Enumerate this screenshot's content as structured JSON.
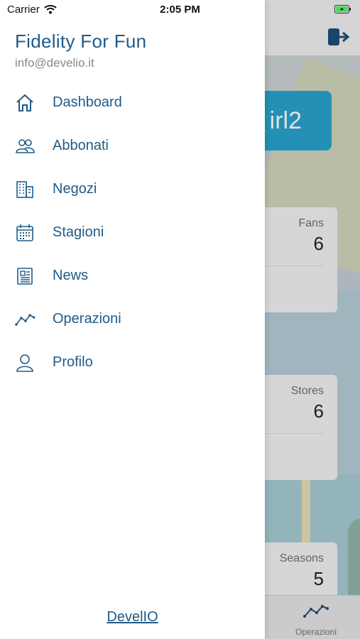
{
  "status_bar": {
    "carrier": "Carrier",
    "time": "2:05 PM",
    "battery_color": "#4cd964"
  },
  "drawer": {
    "title": "Fidelity For Fun",
    "email": "info@develio.it",
    "accent_color": "#215b87",
    "menu": [
      {
        "label": "Dashboard",
        "icon": "home-icon"
      },
      {
        "label": "Abbonati",
        "icon": "users-icon"
      },
      {
        "label": "Negozi",
        "icon": "building-icon"
      },
      {
        "label": "Stagioni",
        "icon": "calendar-icon"
      },
      {
        "label": "News",
        "icon": "newspaper-icon"
      },
      {
        "label": "Operazioni",
        "icon": "trend-icon"
      },
      {
        "label": "Profilo",
        "icon": "user-icon"
      }
    ],
    "footer_link": "DevelIO"
  },
  "background": {
    "banner_text": "irl2",
    "cards": [
      {
        "label": "Fans",
        "value": "6"
      },
      {
        "label": "Stores",
        "value": "6"
      },
      {
        "label": "Seasons",
        "value": "5"
      }
    ],
    "tab_active": {
      "label": "Operazioni",
      "icon": "trend-icon"
    },
    "logout_icon": "logout-icon"
  }
}
